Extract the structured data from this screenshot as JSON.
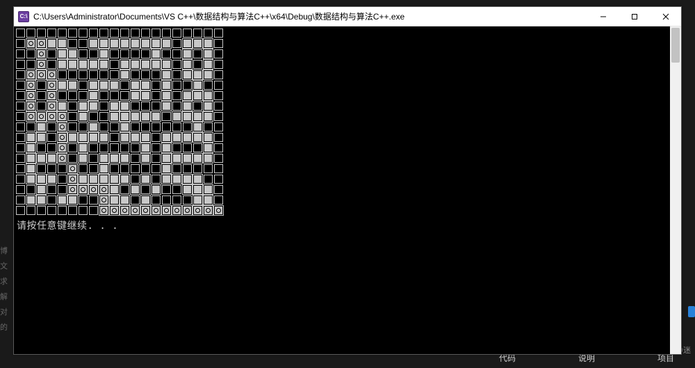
{
  "window": {
    "icon_text": "C:\\",
    "title": "C:\\Users\\Administrator\\Documents\\VS C++\\数据结构与算法C++\\x64\\Debug\\数据结构与算法C++.exe"
  },
  "console": {
    "prompt": "请按任意键继续. . ."
  },
  "maze": {
    "rows": 18,
    "cols": 20,
    "legend": {
      "w": "wall",
      "o": "open",
      "p": "path"
    },
    "grid": [
      "wwwwwwwwwwwwwwwwwwww",
      "wppoowwoooooooowooow",
      "wwpwoowwowwwwowwowow",
      "wwpwooooowooooowowow",
      "wpppwwwwwwowwwowooow",
      "wpwpoowooowoowowwoww",
      "wpwpwwwowwwoowowooow",
      "wpwpowoowoowwwowowow",
      "wppppwowwooooowoooow",
      "wwowpwwowwowwwwwwoww",
      "woowpoooowooowooooow",
      "wowwpwowwwwwowowwwow",
      "wooopwowooowowooooow",
      "wowwwpwwowwwwwowwwww",
      "wooowpooooowowoooowwo",
      "wwowwppppowowowwooow",
      "woowoowwpoowowwwwoow",
      "wwwwwwwwpppppppppppp"
    ]
  },
  "background": {
    "bottom_tabs": [
      "代码",
      "说明",
      "项目"
    ],
    "left_fragments": [
      "博",
      "文",
      "求解",
      "对的"
    ],
    "watermark": "CSDN @迷"
  }
}
